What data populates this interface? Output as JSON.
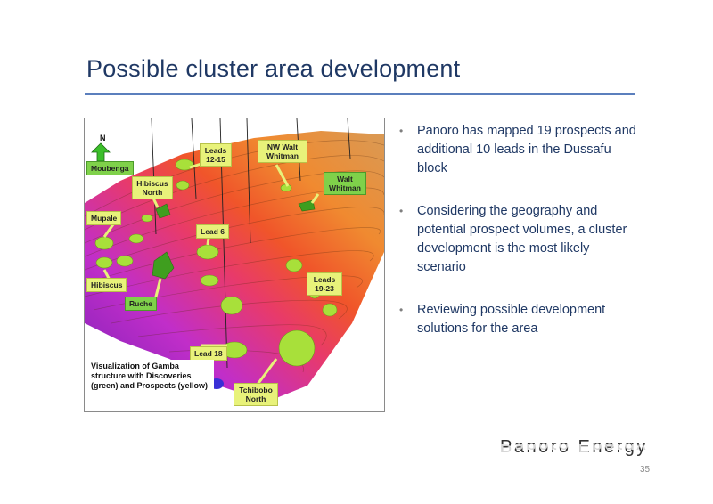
{
  "title": "Possible cluster area development",
  "map": {
    "north": "N",
    "callouts": [
      {
        "id": "moubenga",
        "text": "Moubenga",
        "kind": "discovery"
      },
      {
        "id": "hibiscus-north",
        "text": "Hibiscus North",
        "kind": "prospect"
      },
      {
        "id": "leads-12-15",
        "text": "Leads 12-15",
        "kind": "prospect"
      },
      {
        "id": "nw-walt-whitman",
        "text": "NW Walt Whitman",
        "kind": "prospect"
      },
      {
        "id": "walt-whitman",
        "text": "Walt Whitman",
        "kind": "discovery"
      },
      {
        "id": "mupale",
        "text": "Mupale",
        "kind": "prospect"
      },
      {
        "id": "lead-6",
        "text": "Lead 6",
        "kind": "prospect"
      },
      {
        "id": "hibiscus",
        "text": "Hibiscus",
        "kind": "prospect"
      },
      {
        "id": "ruche",
        "text": "Ruche",
        "kind": "discovery"
      },
      {
        "id": "leads-19-23",
        "text": "Leads 19-23",
        "kind": "prospect"
      },
      {
        "id": "lead-18",
        "text": "Lead 18",
        "kind": "prospect"
      },
      {
        "id": "tchibobo-north",
        "text": "Tchibobo North",
        "kind": "prospect"
      }
    ],
    "caption": "Visualization of Gamba structure with Discoveries (green) and Prospects (yellow)",
    "colors": {
      "discovery": "#7fd14a",
      "prospect": "#e8f27a"
    }
  },
  "bullets": [
    "Panoro has mapped 19 prospects and additional 10 leads in the Dussafu block",
    "Considering the geography and potential prospect volumes, a cluster development is the most likely scenario",
    "Reviewing possible development solutions for the area"
  ],
  "brand": "Panoro Energy",
  "page_number": "35",
  "theme": {
    "title_color": "#1f3864",
    "rule_color": "#5b7fbd"
  }
}
